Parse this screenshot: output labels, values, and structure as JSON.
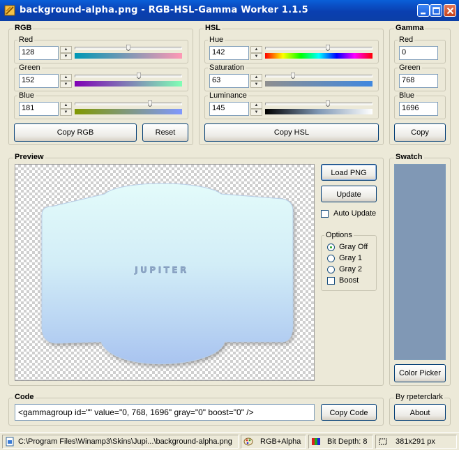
{
  "window": {
    "title": "background-alpha.png - RGB-HSL-Gamma Worker 1.1.5",
    "title_color": "#0a4bc6",
    "accent_color": "#003c74"
  },
  "rgb": {
    "label": "RGB",
    "red": {
      "label": "Red",
      "value": "128",
      "level": 0.5
    },
    "green": {
      "label": "Green",
      "value": "152",
      "level": 0.6
    },
    "blue": {
      "label": "Blue",
      "value": "181",
      "level": 0.71
    },
    "copy_label": "Copy RGB",
    "reset_label": "Reset"
  },
  "hsl": {
    "label": "HSL",
    "hue": {
      "label": "Hue",
      "value": "142",
      "level": 0.59
    },
    "saturation": {
      "label": "Saturation",
      "value": "63",
      "level": 0.25
    },
    "luminance": {
      "label": "Luminance",
      "value": "145",
      "level": 0.59
    },
    "copy_label": "Copy HSL"
  },
  "gamma": {
    "label": "Gamma",
    "red": {
      "label": "Red",
      "value": "0"
    },
    "green": {
      "label": "Green",
      "value": "768"
    },
    "blue": {
      "label": "Blue",
      "value": "1696"
    },
    "copy_label": "Copy"
  },
  "preview": {
    "label": "Preview",
    "logo_text": "JUPITER",
    "load_png_label": "Load PNG",
    "update_label": "Update",
    "auto_update_label": "Auto Update",
    "auto_update_checked": false,
    "options_label": "Options",
    "options": [
      {
        "label": "Gray Off",
        "selected": true
      },
      {
        "label": "Gray 1",
        "selected": false
      },
      {
        "label": "Gray 2",
        "selected": false
      }
    ],
    "boost_label": "Boost",
    "boost_checked": false
  },
  "swatch": {
    "label": "Swatch",
    "color": "#8098b5",
    "picker_label": "Color Picker"
  },
  "code": {
    "label": "Code",
    "value": "<gammagroup id=\"\" value=\"0, 768, 1696\" gray=\"0\" boost=\"0\" />",
    "copy_label": "Copy Code"
  },
  "about": {
    "label": "By rpeterclark",
    "button_label": "About"
  },
  "status": {
    "path": "C:\\Program Files\\Winamp3\\Skins\\Jupi...\\background-alpha.png",
    "mode": "RGB+Alpha",
    "depth": "Bit Depth: 8",
    "size": "381x291 px"
  }
}
